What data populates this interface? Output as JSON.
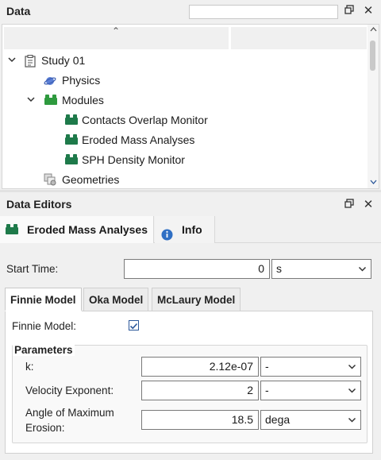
{
  "data_panel": {
    "title": "Data",
    "search": {
      "value": "",
      "placeholder": ""
    },
    "tree": {
      "study": "Study 01",
      "physics": "Physics",
      "modules": "Modules",
      "module_items": [
        "Contacts Overlap Monitor",
        "Eroded Mass Analyses",
        "SPH Density Monitor"
      ],
      "geometries": "Geometries"
    }
  },
  "editors_panel": {
    "title": "Data Editors",
    "tabs": {
      "active": "Eroded Mass Analyses",
      "info": "Info"
    },
    "start_time": {
      "label": "Start Time:",
      "value": "0",
      "unit": "s"
    },
    "subtabs": [
      "Finnie Model",
      "Oka Model",
      "McLaury Model"
    ],
    "finnie": {
      "checkbox_label": "Finnie Model:",
      "checked": true,
      "group_title": "Parameters",
      "params": [
        {
          "label": "k:",
          "value": "2.12e-07",
          "unit": "-"
        },
        {
          "label": "Velocity Exponent:",
          "value": "2",
          "unit": "-"
        },
        {
          "label_line1": "Angle of Maximum",
          "label_line2": "Erosion:",
          "value": "18.5",
          "unit": "dega"
        }
      ]
    }
  },
  "colors": {
    "module_green": "#1e7a4a",
    "info_blue": "#2f6fc4",
    "accent": "#2b579a"
  }
}
